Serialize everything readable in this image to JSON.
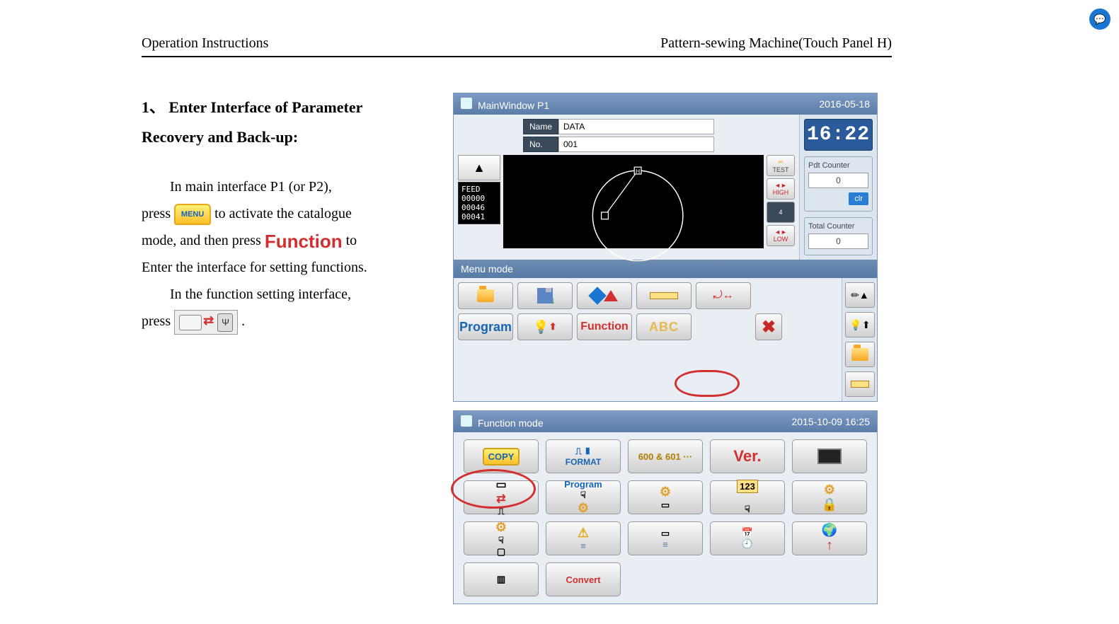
{
  "doc": {
    "header_left": "Operation Instructions",
    "header_right": "Pattern-sewing Machine(Touch Panel H)"
  },
  "text": {
    "heading": "1、 Enter Interface of Parameter Recovery and Back-up:",
    "p1": "In main interface P1 (or P2),",
    "p2a": "press ",
    "p2b": " to activate the catalogue",
    "p3a": "mode, and then press ",
    "p3b": " to",
    "p4": "Enter the interface for setting functions.",
    "p5": "In the function setting interface,",
    "p6a": "press ",
    "p6b": ".",
    "menu_label": "MENU",
    "function_label": "Function"
  },
  "screen1": {
    "title": "MainWindow P1",
    "date": "2016-05-18",
    "name_label": "Name",
    "name_value": "DATA",
    "no_label": "No.",
    "no_value": "001",
    "feed_label": "FEED",
    "feed_rows": [
      "00000",
      "00046",
      "00041"
    ],
    "side": {
      "test": "TEST",
      "high": "HIGH",
      "mid": "4",
      "low": "LOW"
    },
    "clock": "16:22",
    "pdt_counter_label": "Pdt Counter",
    "pdt_counter_value": "0",
    "clr": "clr",
    "total_counter_label": "Total Counter",
    "total_counter_value": "0",
    "menubar": "Menu mode",
    "buttons": {
      "program": "Program",
      "function": "Function",
      "abc": "ABC"
    }
  },
  "screen2": {
    "title": "Function mode",
    "datetime": "2015-10-09 16:25",
    "copy": "COPY",
    "format": "FORMAT",
    "sixhun": "600 & 601 ···",
    "ver": "Ver.",
    "program": "Program",
    "num": "123",
    "convert": "Convert"
  }
}
